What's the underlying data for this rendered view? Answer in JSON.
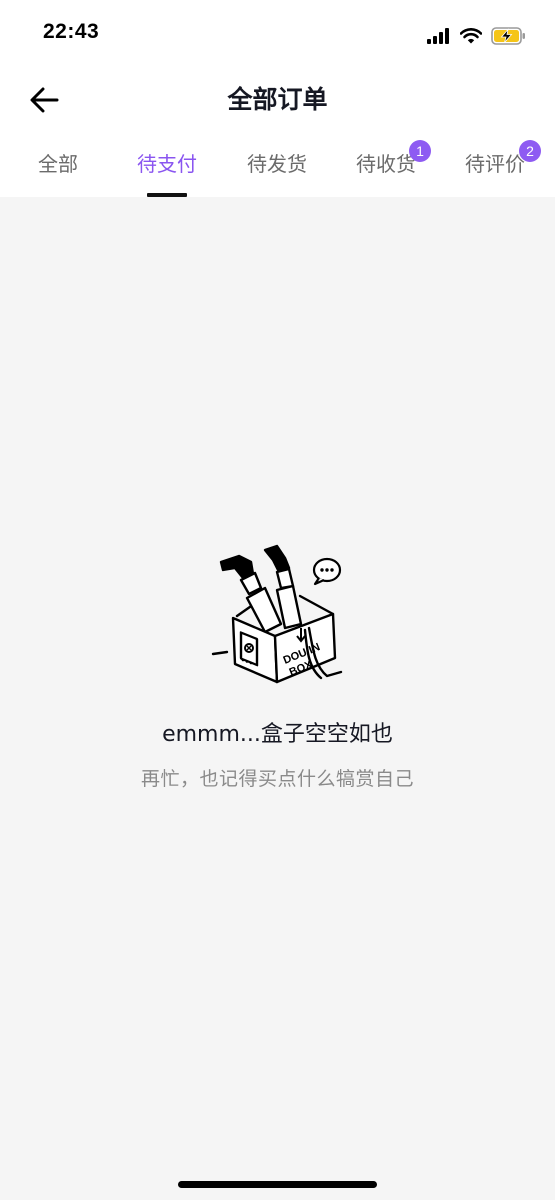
{
  "status_bar": {
    "time": "22:43",
    "icons": [
      "cellular-signal-icon",
      "wifi-icon",
      "battery-charging-icon"
    ]
  },
  "nav": {
    "back_icon": "arrow-left-icon",
    "title": "全部订单"
  },
  "tabs": [
    {
      "label": "全部",
      "badge": null,
      "active": false
    },
    {
      "label": "待支付",
      "badge": null,
      "active": true
    },
    {
      "label": "待发货",
      "badge": null,
      "active": false
    },
    {
      "label": "待收货",
      "badge": "1",
      "active": false
    },
    {
      "label": "待评价",
      "badge": "2",
      "active": false
    }
  ],
  "empty_state": {
    "illustration": "empty-box-illustration-icon",
    "box_text": "DOUYIN BOX",
    "title": "emmm...盒子空空如也",
    "subtitle": "再忙，也记得买点什么犒赏自己"
  },
  "colors": {
    "accent": "#8a55f0",
    "badge": "#8e5bf2",
    "background": "#f5f5f5",
    "header_background": "#ffffff",
    "battery": "#f5c518"
  }
}
